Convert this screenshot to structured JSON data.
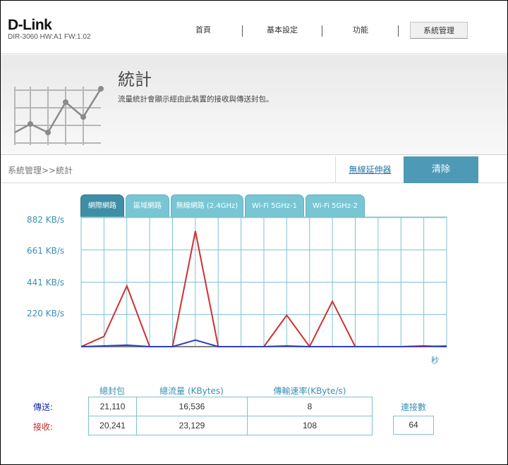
{
  "header": {
    "logo": "D-Link",
    "model": "DIR-3060 HW:A1 FW:1.02",
    "nav": [
      {
        "label": "首頁"
      },
      {
        "label": "基本設定"
      },
      {
        "label": "功能"
      },
      {
        "label": "系統管理"
      }
    ],
    "active_nav": "系統管理"
  },
  "banner": {
    "title": "統計",
    "description": "流量統計會顯示經由此裝置的接收與傳送封包。"
  },
  "breadcrumb": "系統管理>>統計",
  "actions": {
    "extender_link": "無線延伸器",
    "clear_button": "清除"
  },
  "tabs": [
    {
      "label": "網際網路",
      "active": true
    },
    {
      "label": "區域網路",
      "active": false
    },
    {
      "label": "無線網路 (2.4GHz)",
      "active": false
    },
    {
      "label": "Wi-Fi 5GHz-1",
      "active": false
    },
    {
      "label": "Wi-Fi 5GHz-2",
      "active": false
    }
  ],
  "chart_data": {
    "type": "line",
    "y_tick_labels": [
      "882 KB/s",
      "661 KB/s",
      "441 KB/s",
      "220 KB/s"
    ],
    "y_ticks": [
      882,
      661,
      441,
      220
    ],
    "ylim": [
      0,
      882
    ],
    "x_unit": "秒",
    "x_points": 16,
    "grid": true,
    "series": [
      {
        "color": "#d32f2f",
        "values": [
          0,
          70,
          415,
          0,
          0,
          790,
          0,
          0,
          0,
          215,
          0,
          310,
          0,
          0,
          0,
          0,
          5
        ]
      },
      {
        "color": "#2e3fc2",
        "values": [
          0,
          5,
          10,
          0,
          0,
          45,
          0,
          0,
          0,
          5,
          0,
          0,
          0,
          0,
          0,
          5,
          0
        ]
      }
    ]
  },
  "stats": {
    "headers": [
      "總封包",
      "總流量 (KBytes)",
      "傳輸速率(KByte/s)"
    ],
    "rows": [
      {
        "label": "傳送:",
        "color": "#1a2fb0",
        "packets": "21,110",
        "traffic": "16,536",
        "rate": "8"
      },
      {
        "label": "接收:",
        "color": "#c62828",
        "packets": "20,241",
        "traffic": "23,129",
        "rate": "108"
      }
    ],
    "connections_label": "連接數",
    "connections": "64"
  }
}
